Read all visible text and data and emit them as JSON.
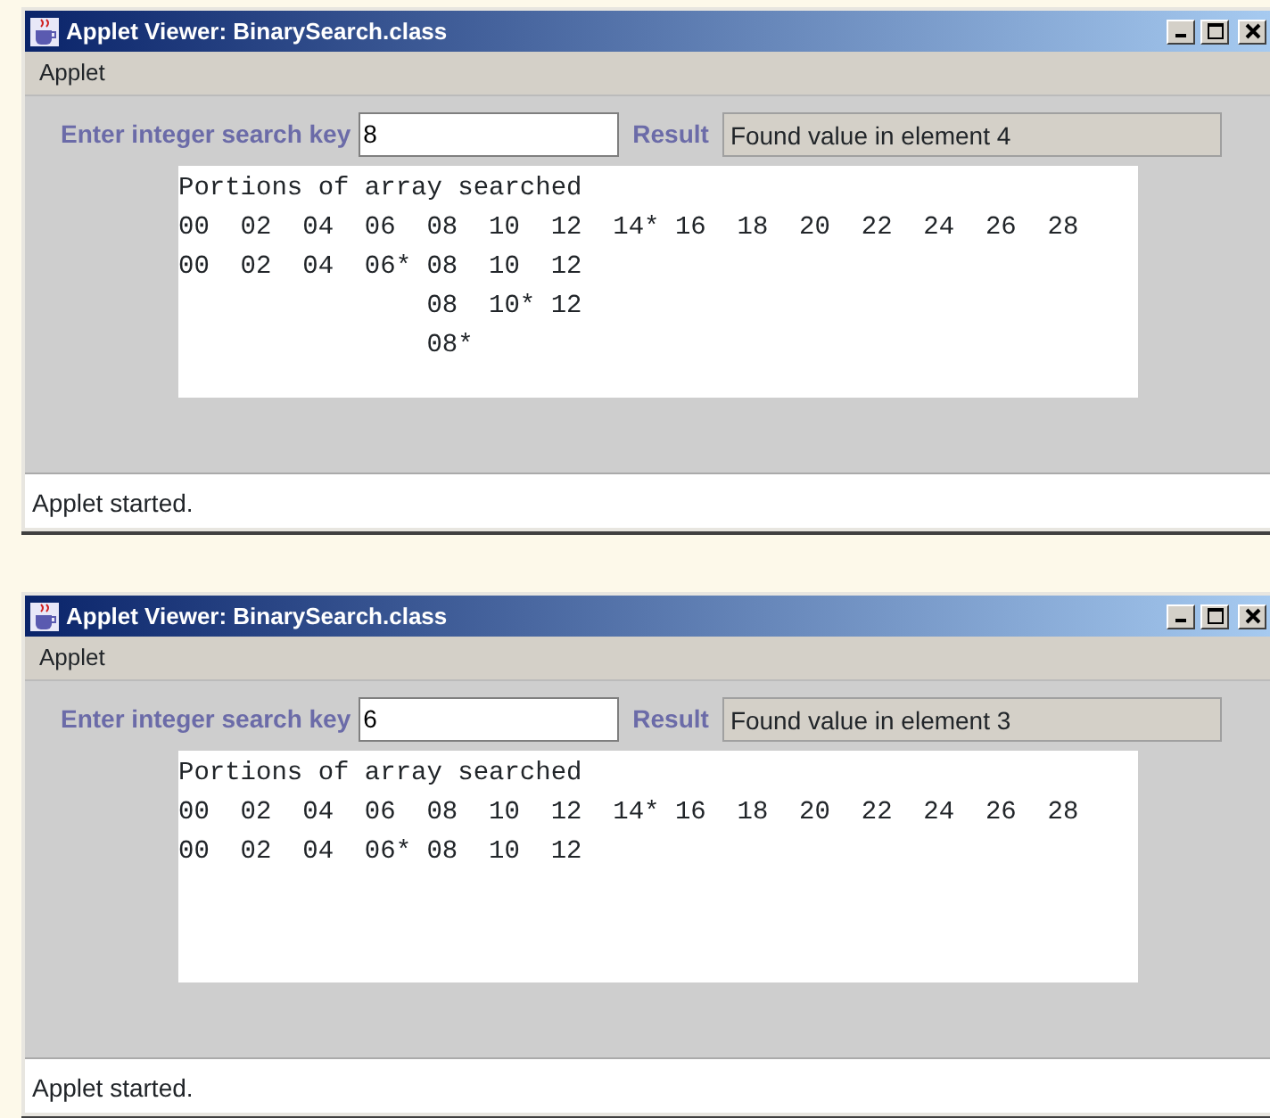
{
  "windows": [
    {
      "title": "Applet Viewer: BinarySearch.class",
      "menu": [
        "Applet"
      ],
      "search_label": "Enter integer search key",
      "search_value": "8",
      "result_label": "Result",
      "result_value": "Found value in element 4",
      "output_lines": [
        "Portions of array searched",
        "00  02  04  06  08  10  12  14* 16  18  20  22  24  26  28",
        "00  02  04  06* 08  10  12",
        "                08  10* 12",
        "                08*"
      ],
      "status": "Applet started."
    },
    {
      "title": "Applet Viewer: BinarySearch.class",
      "menu": [
        "Applet"
      ],
      "search_label": "Enter integer search key",
      "search_value": "6",
      "result_label": "Result",
      "result_value": "Found value in element 3",
      "output_lines": [
        "Portions of array searched",
        "00  02  04  06  08  10  12  14* 16  18  20  22  24  26  28",
        "00  02  04  06* 08  10  12"
      ],
      "status": "Applet started."
    }
  ]
}
